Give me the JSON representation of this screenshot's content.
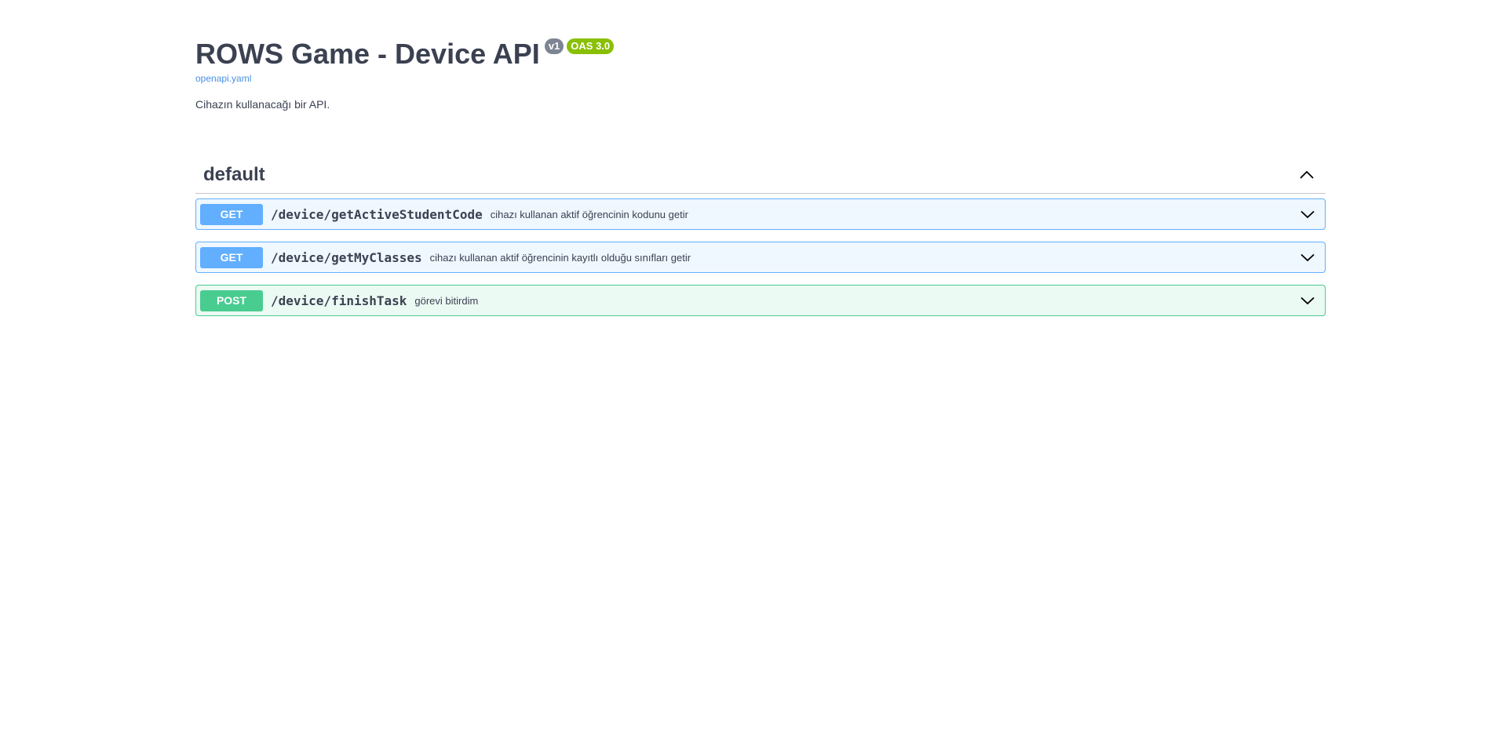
{
  "info": {
    "title": "ROWS Game - Device API",
    "version_badge": "v1",
    "oas_badge": "OAS 3.0",
    "spec_link": "openapi.yaml",
    "description": "Cihazın kullanacağı bir API."
  },
  "section": {
    "title": "default",
    "expanded": true,
    "toggle_icon": "chevron-up-icon"
  },
  "operations": [
    {
      "method": "GET",
      "path": "/device/getActiveStudentCode",
      "summary": "cihazı kullanan aktif öğrencinin kodunu getir",
      "expand_icon": "chevron-down-icon"
    },
    {
      "method": "GET",
      "path": "/device/getMyClasses",
      "summary": "cihazı kullanan aktif öğrencinin kayıtlı olduğu sınıfları getir",
      "expand_icon": "chevron-down-icon"
    },
    {
      "method": "POST",
      "path": "/device/finishTask",
      "summary": "görevi bitirdim",
      "expand_icon": "chevron-down-icon"
    }
  ],
  "colors": {
    "get": "#61affe",
    "post": "#49cc90",
    "version_badge": "#7d8492",
    "oas_badge": "#89bf04",
    "link": "#4990e2",
    "text": "#3b4151"
  }
}
